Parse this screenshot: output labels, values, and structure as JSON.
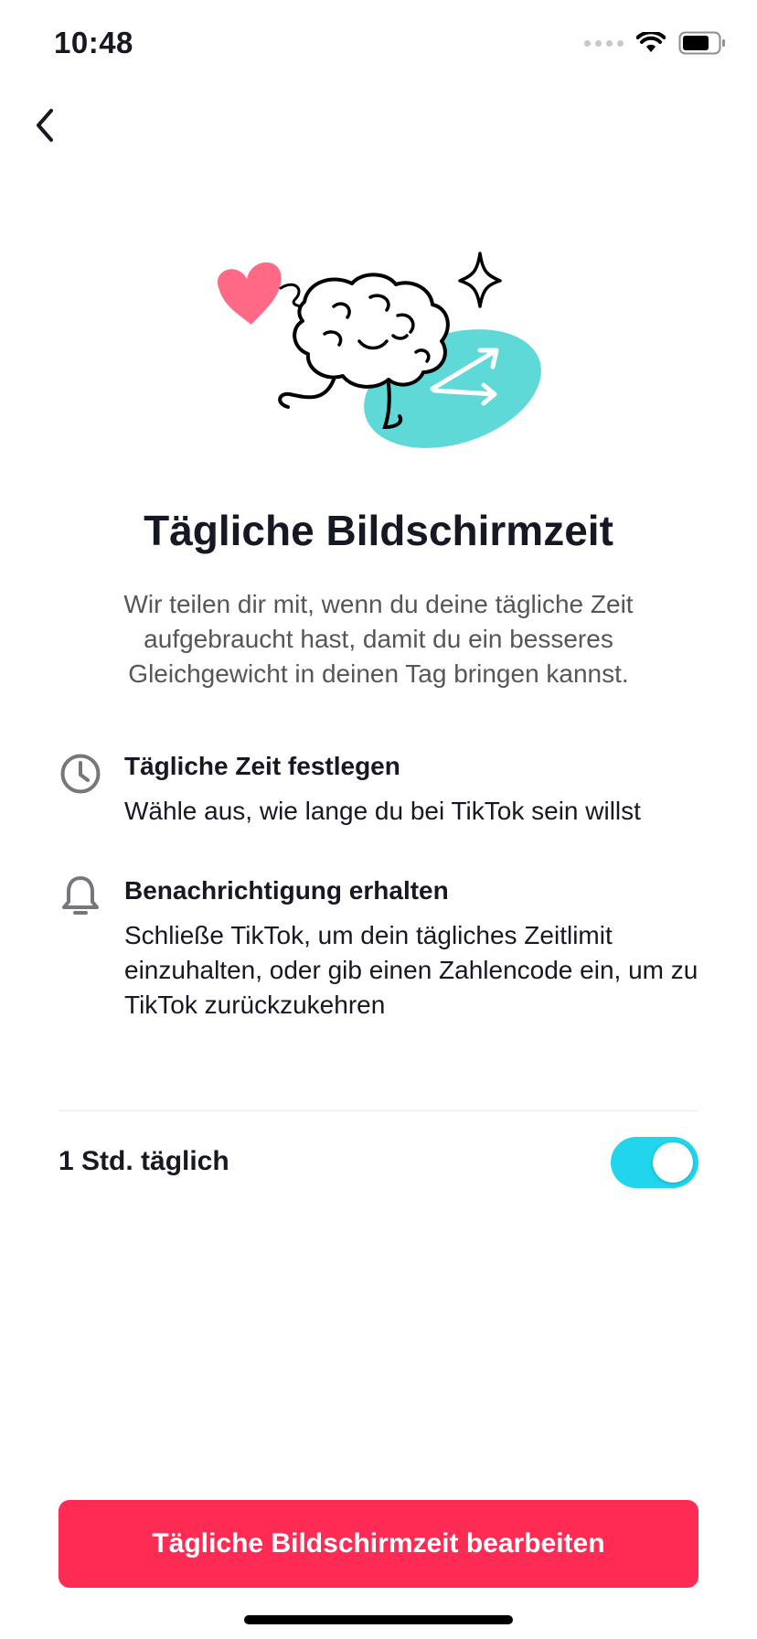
{
  "status_bar": {
    "time": "10:48"
  },
  "header": {
    "back_icon": "chevron-left-icon"
  },
  "illustration": {
    "name": "brain-runner-illustration",
    "colors": {
      "heart": "#fe6a86",
      "teal": "#5fd9d7"
    }
  },
  "main": {
    "title": "Tägliche Bildschirmzeit",
    "description": "Wir teilen dir mit, wenn du deine tägliche Zeit aufgebraucht hast, damit du ein besseres Gleichgewicht in deinen Tag bringen kannst.",
    "features": [
      {
        "icon": "clock-icon",
        "title": "Tägliche Zeit festlegen",
        "text": "Wähle aus, wie lange du bei TikTok sein willst"
      },
      {
        "icon": "bell-icon",
        "title": "Benachrichtigung erhalten",
        "text": "Schließe TikTok, um dein tägliches Zeitlimit einzuhalten, oder gib einen Zahlencode ein, um zu TikTok zurückzukehren"
      }
    ]
  },
  "setting": {
    "label": "1 Std. täglich",
    "enabled": true,
    "toggle_color": "#20d5ec"
  },
  "footer": {
    "button_label": "Tägliche Bildschirmzeit bearbeiten",
    "button_color": "#fe2c55"
  }
}
